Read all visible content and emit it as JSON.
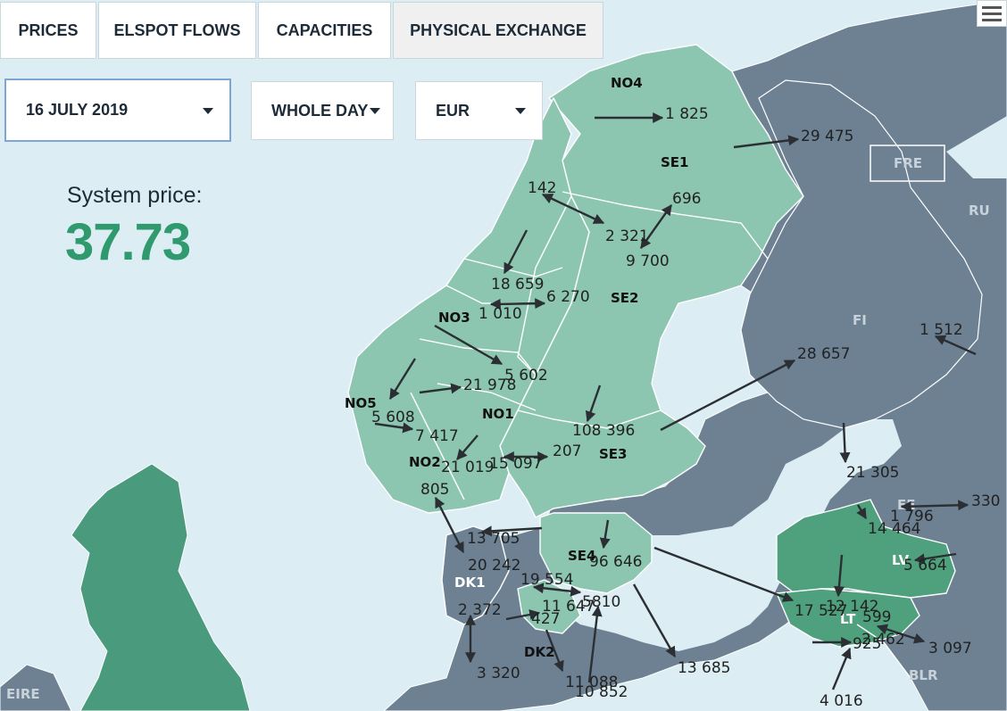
{
  "tabs": [
    {
      "label": "PRICES"
    },
    {
      "label": "ELSPOT FLOWS"
    },
    {
      "label": "CAPACITIES"
    },
    {
      "label": "PHYSICAL EXCHANGE",
      "active": true
    }
  ],
  "filters": {
    "date": "16 JULY 2019",
    "period": "WHOLE DAY",
    "currency": "EUR"
  },
  "system_price": {
    "label": "System price:",
    "value": "37.73"
  },
  "colors": {
    "nordic_area": "#8cc5b0",
    "nordic_area_dark": "#4a9a7d",
    "baltic_area": "#4fa07d",
    "other_area": "#6d8193",
    "sea": "#dcedf3",
    "price_accent": "#2e9a6d"
  },
  "areas": {
    "NO4": "NO4",
    "SE1": "SE1",
    "SE2": "SE2",
    "NO3": "NO3",
    "NO5": "NO5",
    "NO1": "NO1",
    "NO2": "NO2",
    "SE3": "SE3",
    "SE4": "SE4",
    "DK1": "DK1",
    "DK2": "DK2",
    "FI": "FI",
    "RU": "RU",
    "FRE": "FRE",
    "EE": "EE",
    "LV": "LV",
    "LT": "LT",
    "BLR": "BLR",
    "EIRE": "EIRE"
  },
  "flows": {
    "f1825": "1 825",
    "f29475": "29 475",
    "f142": "142",
    "f696": "696",
    "f2321": "2 321",
    "f9700": "9 700",
    "f18659": "18 659",
    "f6270": "6 270",
    "f1010": "1 010",
    "f5602": "5 602",
    "f21978": "21 978",
    "f5608": "5 608",
    "f7417": "7 417",
    "f21019": "21 019",
    "f15097": "15 097",
    "f207": "207",
    "f108396": "108 396",
    "f805": "805",
    "f13705": "13 705",
    "f20242": "20 242",
    "f19554": "19 554",
    "f96646": "96 646",
    "f5810": "5810",
    "f11647": "11 647",
    "f427": "427",
    "f2372": "2 372",
    "f3320": "3 320",
    "f11088": "11 088",
    "f10852": "10 852",
    "f13685": "13 685",
    "f28657": "28 657",
    "f1512": "1 512",
    "f21305": "21 305",
    "f330": "330",
    "f1796": "1 796",
    "f14464": "14 464",
    "f5664": "5 664",
    "f12142": "12 142",
    "f17527": "17 527",
    "f599": "599",
    "f2462": "2 462",
    "f925": "925",
    "f3097": "3 097",
    "f4016": "4 016"
  }
}
